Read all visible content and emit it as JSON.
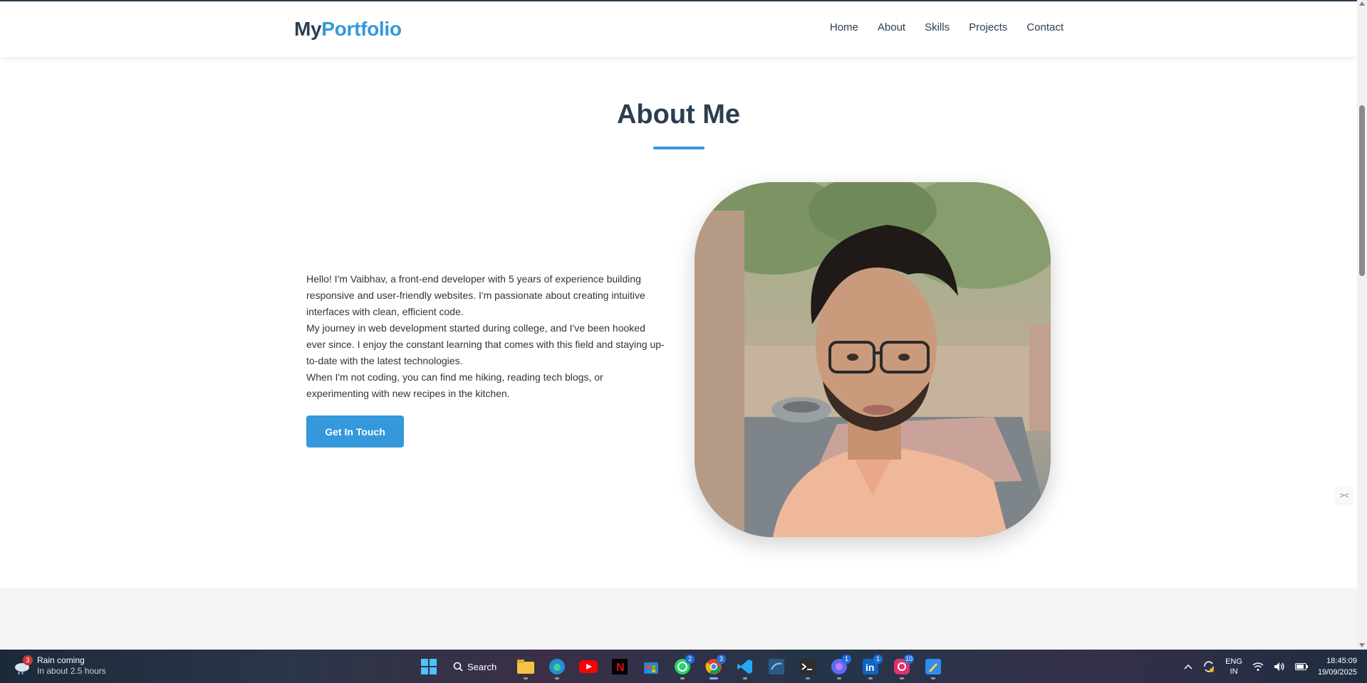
{
  "navbar": {
    "logo_part1": "My",
    "logo_part2": "Portfolio",
    "links": [
      "Home",
      "About",
      "Skills",
      "Projects",
      "Contact"
    ]
  },
  "about": {
    "title": "About Me",
    "paragraphs": [
      "Hello! I'm Vaibhav, a front-end developer with 5 years of experience building responsive and user-friendly websites. I'm passionate about creating intuitive interfaces with clean, efficient code.",
      "My journey in web development started during college, and I've been hooked ever since. I enjoy the constant learning that comes with this field and staying up-to-date with the latest technologies.",
      "When I'm not coding, you can find me hiking, reading tech blogs, or experimenting with new recipes in the kitchen."
    ],
    "button_label": "Get In Touch"
  },
  "colors": {
    "accent": "#3498db",
    "heading": "#2c3e50"
  },
  "taskbar": {
    "weather_title": "Rain coming",
    "weather_sub": "In about 2.5 hours",
    "weather_badge": "3",
    "search_label": "Search",
    "badges": {
      "whatsapp": "2",
      "chrome": "3",
      "copilot": "1",
      "linkedin": "1",
      "instagram": "10"
    },
    "lang_top": "ENG",
    "lang_bottom": "IN",
    "time": "18:45:09",
    "date": "19/09/2025"
  }
}
